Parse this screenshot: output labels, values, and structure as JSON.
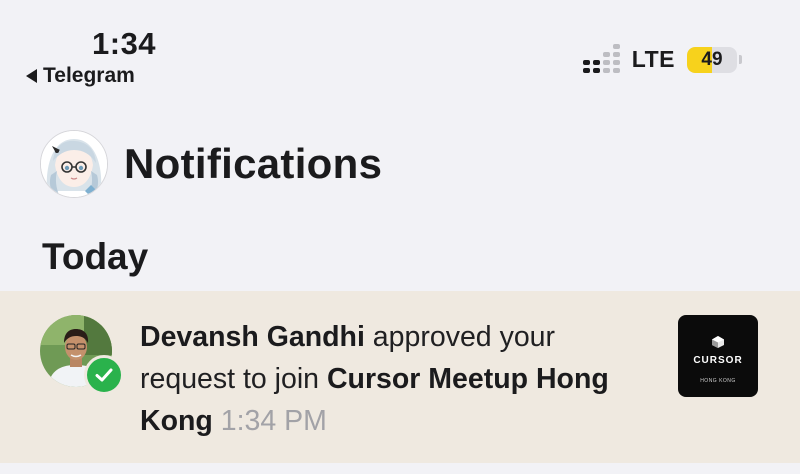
{
  "status_bar": {
    "time": "1:34",
    "back_app": "Telegram",
    "network": "LTE",
    "battery_level": "49",
    "battery_fraction": 0.49,
    "signal_bars_active": 2
  },
  "header": {
    "title": "Notifications",
    "avatar_icon": "anime-avatar-icon"
  },
  "section": {
    "title": "Today"
  },
  "notification": {
    "actor": "Devansh Gandhi",
    "action": " approved your request to join ",
    "group": "Cursor Meetup Hong Kong",
    "time": "1:34 PM",
    "badge_icon": "checkmark-icon",
    "badge_color": "#2ab24c",
    "thumbnail": {
      "title": "CURSOR",
      "subtitle": "HONG KONG"
    }
  },
  "colors": {
    "background": "#f2f2f6",
    "highlight_row": "#efe9e0",
    "battery_fill": "#f7d21c",
    "secondary_text": "#a2a2a7"
  }
}
